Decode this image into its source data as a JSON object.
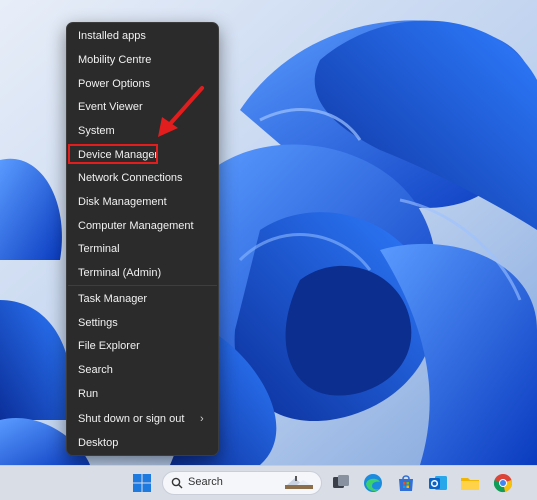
{
  "context_menu": {
    "groups": [
      [
        "Installed apps",
        "Mobility Centre",
        "Power Options",
        "Event Viewer",
        "System",
        "Device Manager",
        "Network Connections",
        "Disk Management",
        "Computer Management",
        "Terminal",
        "Terminal (Admin)"
      ],
      [
        "Task Manager",
        "Settings",
        "File Explorer",
        "Search",
        "Run",
        "Shut down or sign out",
        "Desktop"
      ]
    ],
    "submenu_item": "Shut down or sign out",
    "highlighted_item": "Device Manager",
    "highlight_color": "#e11d1d"
  },
  "annotation": {
    "arrow_color": "#e11d1d"
  },
  "taskbar": {
    "search_placeholder": "Search",
    "icons": [
      "windows-start-icon",
      "search-icon",
      "task-view-icon",
      "edge-icon",
      "store-icon",
      "outlook-icon",
      "file-explorer-icon",
      "chrome-icon"
    ]
  },
  "colors": {
    "menu_bg": "#2b2b2b",
    "menu_text": "#f1f1f1",
    "wallpaper": "#1e5fe0"
  }
}
